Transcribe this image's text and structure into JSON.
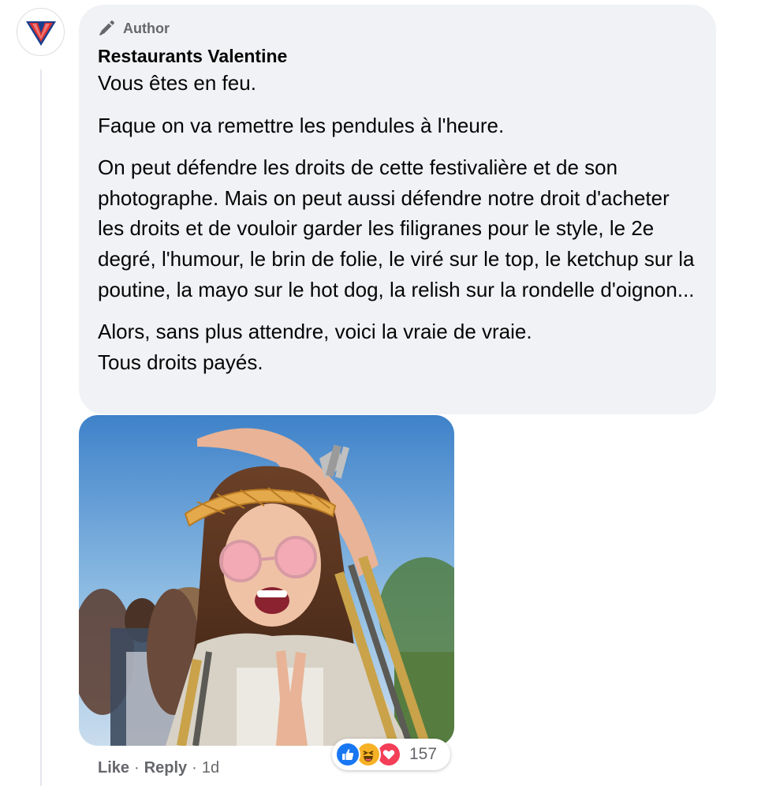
{
  "comment": {
    "badge_label": "Author",
    "author_name": "Restaurants Valentine",
    "paragraphs": [
      "Vous êtes en feu.",
      "Faque on va remettre les pendules à l'heure.",
      "On peut défendre les droits de cette festivalière et de son photographe. Mais on peut aussi défendre notre droit d'acheter les droits et de vouloir garder les filigranes pour le style, le 2e degré, l'humour, le brin de folie, le viré sur le top, le ketchup sur la poutine, la mayo sur le hot dog, la relish sur la rondelle d'oignon...",
      "Alors, sans plus attendre, voici la vraie de vraie.",
      "Tous droits payés."
    ],
    "avatar_logo_letter": "V",
    "avatar_icon": "valentine-logo-icon",
    "badge_icon": "pencil-icon"
  },
  "actions": {
    "like": "Like",
    "separator": "·",
    "reply": "Reply",
    "time": "1d"
  },
  "reactions": {
    "icons": [
      "like-icon",
      "haha-icon",
      "love-icon"
    ],
    "count": "157"
  },
  "colors": {
    "bubble_bg": "#f0f2f5",
    "secondary_text": "#65676b",
    "like_blue": "#1877f2",
    "haha_yellow": "#f7b125",
    "love_red": "#f33e58",
    "logo_red": "#e0322f",
    "logo_blue": "#1b3f8f"
  }
}
